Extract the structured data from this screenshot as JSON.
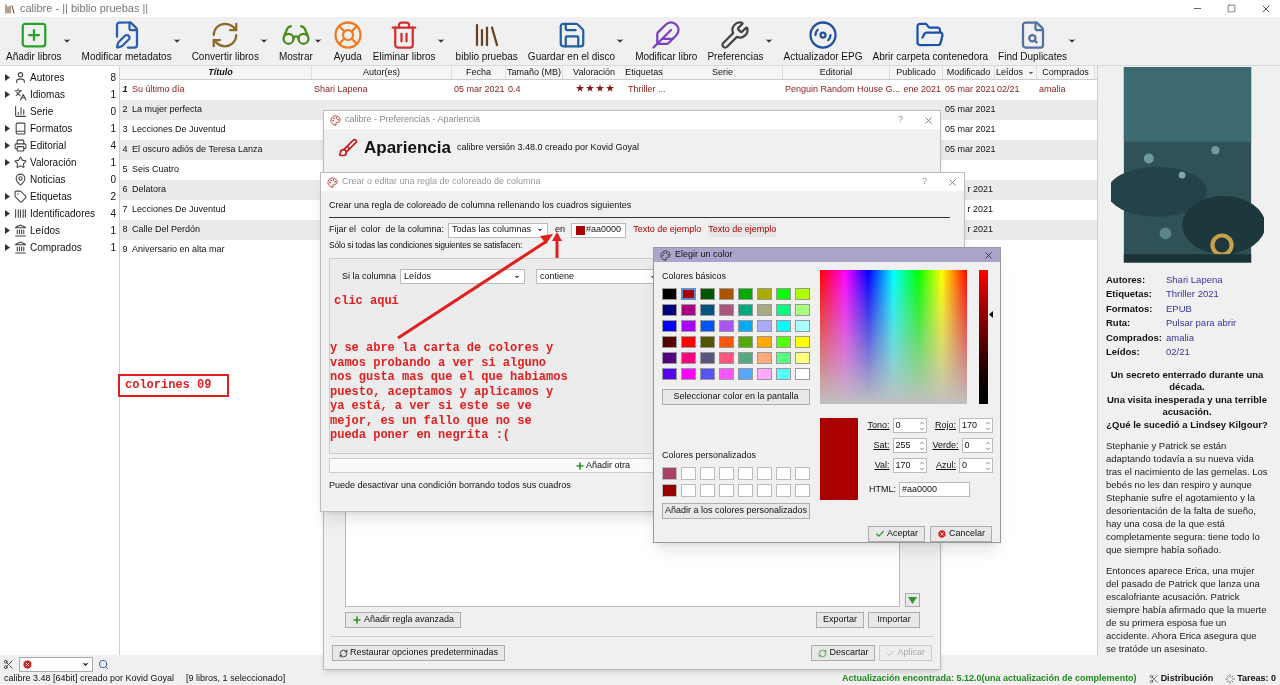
{
  "window": {
    "title": "calibre - || biblio pruebas ||"
  },
  "toolbar": [
    {
      "label": "Añadir libros",
      "dropdown": true
    },
    {
      "label": "Modificar metadatos",
      "dropdown": true
    },
    {
      "label": "Convertir libros",
      "dropdown": true
    },
    {
      "label": "Mostrar",
      "dropdown": true
    },
    {
      "label": "Ayuda",
      "dropdown": false
    },
    {
      "label": "Eliminar libros",
      "dropdown": true
    },
    {
      "label": "biblio pruebas",
      "dropdown": false
    },
    {
      "label": "Guardar en el disco",
      "dropdown": true
    },
    {
      "label": "Modificar libro",
      "dropdown": false
    },
    {
      "label": "Preferencias",
      "dropdown": true
    },
    {
      "label": "Actualizador EPG",
      "dropdown": false
    },
    {
      "label": "Abrir carpeta contenedora",
      "dropdown": false
    },
    {
      "label": "Find Duplicates",
      "dropdown": true
    }
  ],
  "sidebar": [
    {
      "label": "Autores",
      "count": "8",
      "expandable": true
    },
    {
      "label": "Idiomas",
      "count": "1",
      "expandable": true
    },
    {
      "label": "Serie",
      "count": "0",
      "expandable": false
    },
    {
      "label": "Formatos",
      "count": "1",
      "expandable": true
    },
    {
      "label": "Editorial",
      "count": "4",
      "expandable": true
    },
    {
      "label": "Valoración",
      "count": "1",
      "expandable": true
    },
    {
      "label": "Noticias",
      "count": "0",
      "expandable": false
    },
    {
      "label": "Etiquetas",
      "count": "2",
      "expandable": true
    },
    {
      "label": "Identificadores",
      "count": "4",
      "expandable": true
    },
    {
      "label": "Leídos",
      "count": "1",
      "expandable": true
    },
    {
      "label": "Comprados",
      "count": "1",
      "expandable": true
    }
  ],
  "table": {
    "columns": [
      {
        "label": "Título",
        "sorted": false
      },
      {
        "label": "Autor(es)",
        "sorted": false
      },
      {
        "label": "Fecha",
        "sorted": false
      },
      {
        "label": "Tamaño (MB)",
        "sorted": false
      },
      {
        "label": "Valoración",
        "sorted": false
      },
      {
        "label": "Etiquetas",
        "sorted": false
      },
      {
        "label": "Serie",
        "sorted": false
      },
      {
        "label": "Editorial",
        "sorted": false
      },
      {
        "label": "Publicado",
        "sorted": false
      },
      {
        "label": "Modificado",
        "sorted": false
      },
      {
        "label": "Leídos",
        "sorted": true
      },
      {
        "label": "Comprados",
        "sorted": false
      }
    ],
    "rows": [
      {
        "number": "1",
        "colored": true,
        "title": "Su último día",
        "authors": "Shari Lapena",
        "date": "05 mar 2021",
        "size": "0.4",
        "stars": 4,
        "tags": "Thriller ...",
        "publisher": "Penguin Random House G...",
        "published": "ene 2021",
        "modified": "05 mar 2021",
        "read": "02/21",
        "bought": "amalia"
      },
      {
        "number": "2",
        "colored": false,
        "title": "La mujer perfecta",
        "modified": "05 mar 2021"
      },
      {
        "number": "3",
        "colored": false,
        "title": "Lecciones De Juventud",
        "modified": "05 mar 2021"
      },
      {
        "number": "4",
        "colored": false,
        "title": "El oscuro adiós de Teresa Lanza",
        "modified": "05 mar 2021"
      },
      {
        "number": "5",
        "colored": false,
        "title": "Seis Cuatro"
      },
      {
        "number": "6",
        "colored": false,
        "title": "Delatora",
        "modified": "r 2021"
      },
      {
        "number": "7",
        "colored": false,
        "title": "Lecciones De Juventud",
        "modified": "r 2021"
      },
      {
        "number": "8",
        "colored": false,
        "title": "Calle Del Perdón",
        "modified": "r 2021"
      },
      {
        "number": "9",
        "colored": false,
        "title": "Aniversario en alta mar"
      }
    ]
  },
  "book_details": {
    "cover": {
      "kind": "picture"
    },
    "fields": [
      {
        "label": "Autores:",
        "value": "Shari Lapena"
      },
      {
        "label": "Etiquetas:",
        "value": "Thriller 2021"
      },
      {
        "label": "Formatos:",
        "value": "EPUB"
      },
      {
        "label": "Ruta:",
        "value": "Pulsar para abrir"
      },
      {
        "label": "Comprados:",
        "value": "amalia"
      },
      {
        "label": "Leídos:",
        "value": "02/21"
      }
    ],
    "tagline": [
      "Un secreto enterrado durante una década.",
      "Una visita inesperada y una terrible acusación.",
      "¿Qué le sucedió a Lindsey Kilgour?"
    ],
    "description": [
      "Stephanie y Patrick se están adaptando todavía a su nueva vida tras el nacimiento de las gemelas. Los bebés no les dan respiro y aunque Stephanie sufre el agotamiento y la desorientación de la falta de sueño, hay una cosa de la que está completamente segura: tiene todo lo que siempre había soñado.",
      "Entonces aparece Erica, una mujer del pasado de Patrick que lanza una escalofriante acusación. Patrick siempre había afirmado que la muerte de su primera esposa fue un accidente. Ahora Erica asegura que se tratóde un asesinato."
    ]
  },
  "status_bar": {
    "left": "calibre 3.48 [64bit] creado por Kovid Goyal",
    "count": "[9 libros, 1 seleccionado]",
    "update": "Actualización encontrada: 5.12.0(una actualización de complemento)",
    "distribution": "Distribución",
    "jobs": "Tareas: 0"
  },
  "preferences_dialog": {
    "title": "calibre - Preferencias - Apariencia",
    "help": "?",
    "heading": "Apariencia",
    "subtitle": "calibre versión 3.48.0 creado por Kovid Goyal",
    "add_advanced": "Añadir regla avanzada",
    "export": "Exportar",
    "import": "Importar",
    "restore": "Restaurar opciones predeterminadas",
    "discard": "Descartar",
    "apply": {
      "label": "Aplicar",
      "disabled": true
    }
  },
  "rule_dialog": {
    "title": "Crear o editar una regla de coloreado de columna",
    "help": "?",
    "intro": "Crear una regla de coloreado de columna rellenando los cuadros siguientes",
    "set_label": "Fijar el  color  de la columna:",
    "column": "Todas las columnas",
    "in_label": "en",
    "color": "#aa0000",
    "samples": [
      "Texto de ejemplo",
      "Texto de ejemplo"
    ],
    "conditions_label": "Sólo si todas las condiciones siguientes se satisfacen:",
    "condition": {
      "label": "Si la columna",
      "column": "Leídos",
      "operator": "contiene"
    },
    "add_condition": "Añadir otra",
    "footnote": "Puede desactivar una condición borrando todos sus cuadros"
  },
  "annotations": {
    "click_here": "clic aquí",
    "explanation": "y se abre la carta de colores y\nvamos probando a ver si alguno\nnos gusta mas que el que habiamos\npuesto, aceptamos y aplicamos y\nya está, a ver si este se ve\nmejor, es un fallo que no se\npueda poner en negrita :(",
    "label": "colorines 09"
  },
  "color_dialog": {
    "title": "Elegir un color",
    "basic_label": "Colores básicos",
    "basic_colors": [
      {
        "color": "#000000",
        "selected": false
      },
      {
        "color": "#aa0000",
        "selected": true
      },
      {
        "color": "#005500",
        "selected": false
      },
      {
        "color": "#aa5500",
        "selected": false
      },
      {
        "color": "#00aa00",
        "selected": false
      },
      {
        "color": "#aaaa00",
        "selected": false
      },
      {
        "color": "#00ff00",
        "selected": false
      },
      {
        "color": "#aaff00",
        "selected": false
      },
      {
        "color": "#00007f",
        "selected": false
      },
      {
        "color": "#aa007f",
        "selected": false
      },
      {
        "color": "#00557f",
        "selected": false
      },
      {
        "color": "#aa557f",
        "selected": false
      },
      {
        "color": "#00aa7f",
        "selected": false
      },
      {
        "color": "#aaaa7f",
        "selected": false
      },
      {
        "color": "#00ff7f",
        "selected": false
      },
      {
        "color": "#aaff7f",
        "selected": false
      },
      {
        "color": "#0000ff",
        "selected": false
      },
      {
        "color": "#aa00ff",
        "selected": false
      },
      {
        "color": "#0055ff",
        "selected": false
      },
      {
        "color": "#aa55ff",
        "selected": false
      },
      {
        "color": "#00aaff",
        "selected": false
      },
      {
        "color": "#aaaaff",
        "selected": false
      },
      {
        "color": "#00ffff",
        "selected": false
      },
      {
        "color": "#aaffff",
        "selected": false
      },
      {
        "color": "#550000",
        "selected": false
      },
      {
        "color": "#ff0000",
        "selected": false
      },
      {
        "color": "#555500",
        "selected": false
      },
      {
        "color": "#ff5500",
        "selected": false
      },
      {
        "color": "#55aa00",
        "selected": false
      },
      {
        "color": "#ffaa00",
        "selected": false
      },
      {
        "color": "#55ff00",
        "selected": false
      },
      {
        "color": "#ffff00",
        "selected": false
      },
      {
        "color": "#55007f",
        "selected": false
      },
      {
        "color": "#ff007f",
        "selected": false
      },
      {
        "color": "#55557f",
        "selected": false
      },
      {
        "color": "#ff557f",
        "selected": false
      },
      {
        "color": "#55aa7f",
        "selected": false
      },
      {
        "color": "#ffaa7f",
        "selected": false
      },
      {
        "color": "#55ff7f",
        "selected": false
      },
      {
        "color": "#ffff7f",
        "selected": false
      },
      {
        "color": "#5500ff",
        "selected": false
      },
      {
        "color": "#ff00ff",
        "selected": false
      },
      {
        "color": "#5555ff",
        "selected": false
      },
      {
        "color": "#ff55ff",
        "selected": false
      },
      {
        "color": "#55aaff",
        "selected": false
      },
      {
        "color": "#ffaaff",
        "selected": false
      },
      {
        "color": "#55ffff",
        "selected": false
      },
      {
        "color": "#ffffff",
        "selected": false
      }
    ],
    "pick_screen": "Seleccionar color en la pantalla",
    "custom_label": "Colores personalizados",
    "custom_colors": [
      {
        "color": "#a8406a"
      },
      {
        "color": "#ffffff"
      },
      {
        "color": "#ffffff"
      },
      {
        "color": "#ffffff"
      },
      {
        "color": "#ffffff"
      },
      {
        "color": "#ffffff"
      },
      {
        "color": "#ffffff"
      },
      {
        "color": "#ffffff"
      },
      {
        "color": "#990000"
      },
      {
        "color": "#ffffff"
      },
      {
        "color": "#ffffff"
      },
      {
        "color": "#ffffff"
      },
      {
        "color": "#ffffff"
      },
      {
        "color": "#ffffff"
      },
      {
        "color": "#ffffff"
      },
      {
        "color": "#ffffff"
      }
    ],
    "add_custom": "Añadir a los colores personalizados",
    "current": "#aa0000",
    "value_slider": {
      "level": 0.67
    },
    "fields": [
      {
        "label": "Tono:",
        "value": "0"
      },
      {
        "label": "Rojo:",
        "value": "170"
      },
      {
        "label": "Sat:",
        "value": "255"
      },
      {
        "label": "Verde:",
        "value": "0"
      },
      {
        "label": "Val:",
        "value": "170"
      },
      {
        "label": "Azul:",
        "value": "0"
      }
    ],
    "html_label": "HTML:",
    "html_value": "#aa0000",
    "ok": "Aceptar",
    "cancel": "Cancelar"
  }
}
